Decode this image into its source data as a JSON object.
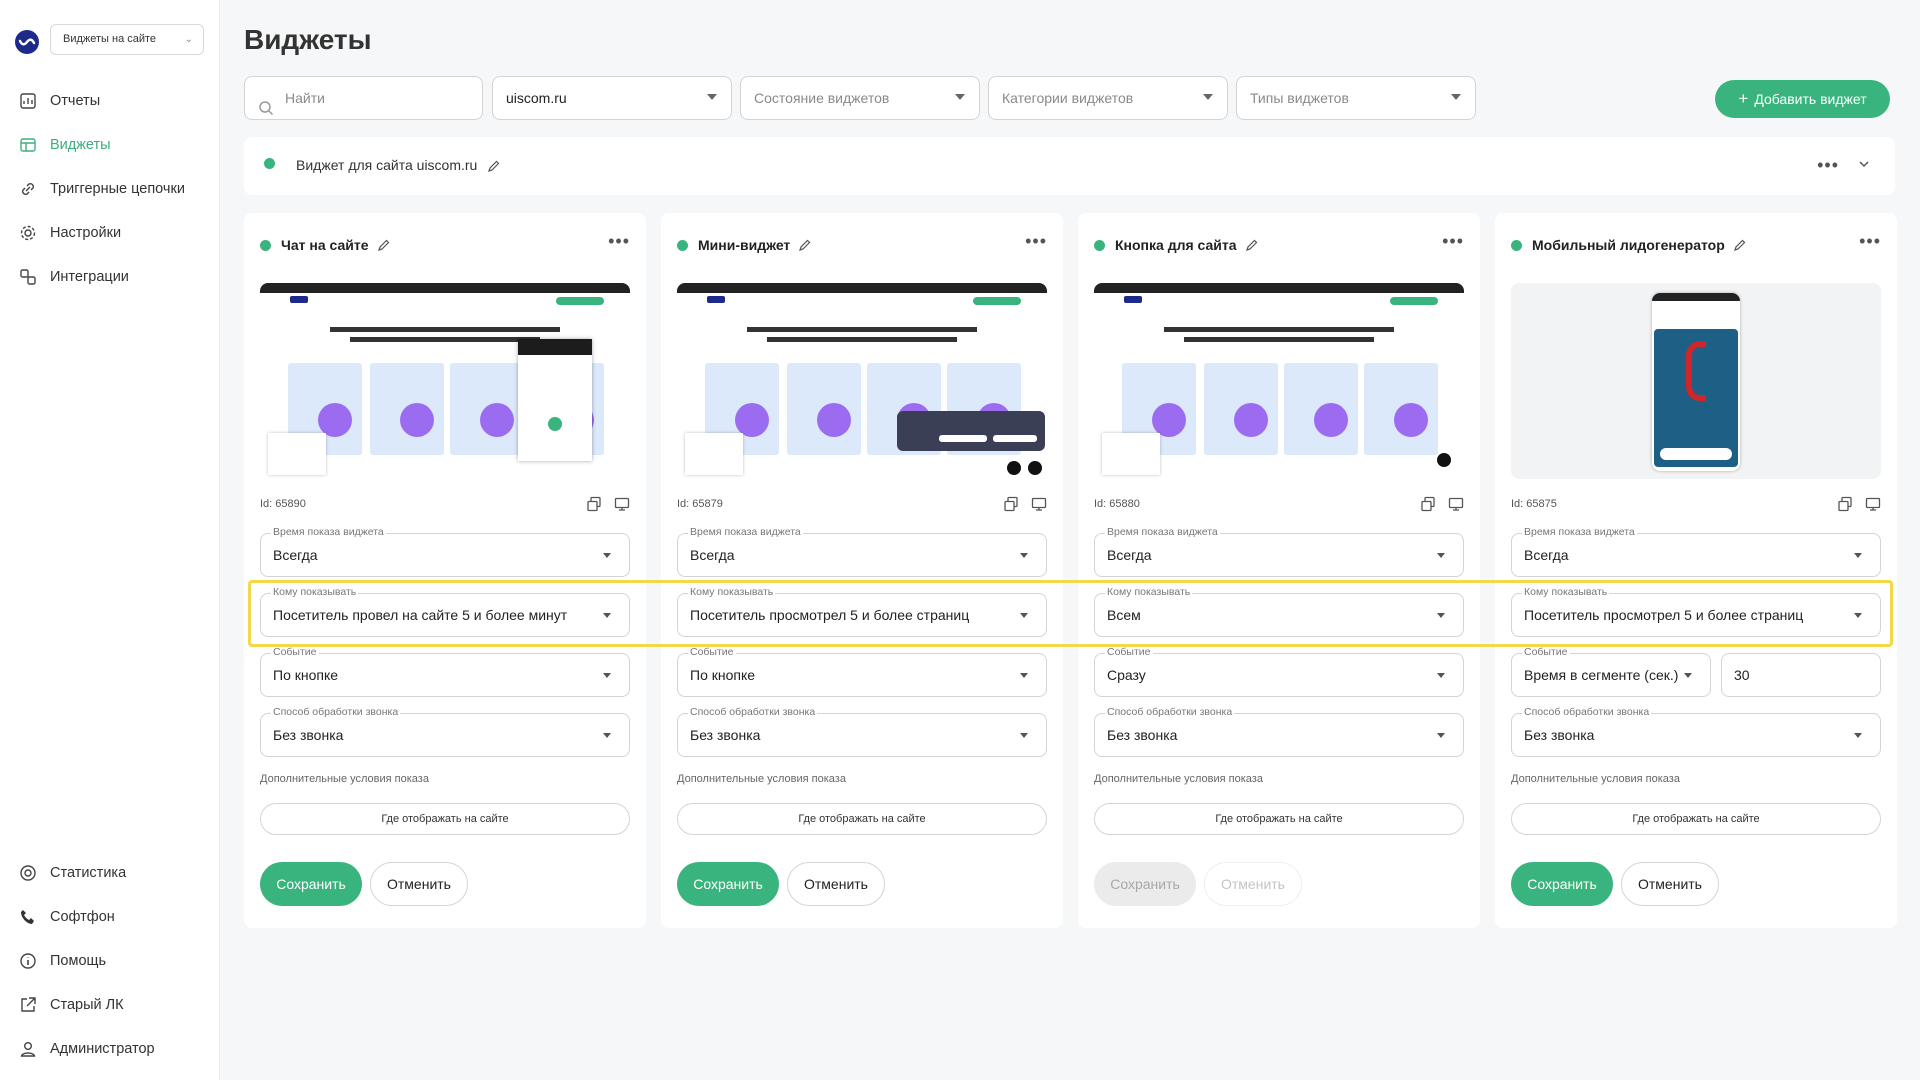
{
  "sidebar": {
    "project_select": "Виджеты на сайте",
    "top_items": [
      {
        "label": "Отчеты",
        "icon": "reports-icon"
      },
      {
        "label": "Виджеты",
        "icon": "widgets-icon",
        "active": true
      },
      {
        "label": "Триггерные цепочки",
        "icon": "chain-icon"
      },
      {
        "label": "Настройки",
        "icon": "gear-icon"
      },
      {
        "label": "Интеграции",
        "icon": "integrations-icon"
      }
    ],
    "bottom_items": [
      {
        "label": "Статистика",
        "icon": "statistics-icon"
      },
      {
        "label": "Софтфон",
        "icon": "phone-icon"
      },
      {
        "label": "Помощь",
        "icon": "help-icon"
      },
      {
        "label": "Старый ЛК",
        "icon": "external-link-icon"
      },
      {
        "label": "Администратор",
        "icon": "user-icon"
      }
    ]
  },
  "page": {
    "title": "Виджеты"
  },
  "filters": {
    "search_placeholder": "Найти",
    "site": "uiscom.ru",
    "state_placeholder": "Состояние виджетов",
    "categories_placeholder": "Категории виджетов",
    "types_placeholder": "Типы виджетов",
    "add_button": "Добавить виджет"
  },
  "site_panel": {
    "title": "Виджет для сайта uiscom.ru"
  },
  "labels": {
    "time": "Время показа виджета",
    "audience": "Кому показывать",
    "event": "Событие",
    "call": "Способ обработки звонка",
    "extra": "Дополнительные условия показа",
    "where": "Где отображать на сайте",
    "save": "Сохранить",
    "cancel": "Отменить"
  },
  "cards": [
    {
      "title": "Чат на сайте",
      "id": "Id: 65890",
      "time": "Всегда",
      "audience": "Посетитель провел на сайте 5 и более минут",
      "event": "По кнопке",
      "call": "Без звонка",
      "save_enabled": true
    },
    {
      "title": "Мини-виджет",
      "id": "Id: 65879",
      "time": "Всегда",
      "audience": "Посетитель просмотрел 5 и более страниц",
      "event": "По кнопке",
      "call": "Без звонка",
      "save_enabled": true
    },
    {
      "title": "Кнопка для сайта",
      "id": "Id: 65880",
      "time": "Всегда",
      "audience": "Всем",
      "event": "Сразу",
      "call": "Без звонка",
      "save_enabled": false
    },
    {
      "title": "Мобильный лидогенератор",
      "id": "Id: 65875",
      "time": "Всегда",
      "audience": "Посетитель просмотрел 5 и более страниц",
      "event": "Время в сегменте (сек.)",
      "event_value": "30",
      "call": "Без звонка",
      "save_enabled": true
    }
  ],
  "colors": {
    "accent": "#3ab47e",
    "highlight": "#f2d84a",
    "brand": "#1d2a8a"
  }
}
